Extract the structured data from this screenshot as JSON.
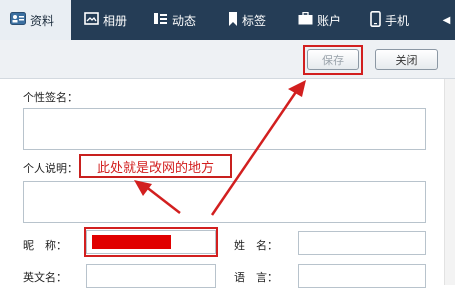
{
  "tabs": [
    {
      "label": "资料",
      "icon": "profile-card-icon"
    },
    {
      "label": "相册",
      "icon": "photo-album-icon"
    },
    {
      "label": "动态",
      "icon": "feed-list-icon"
    },
    {
      "label": "标签",
      "icon": "bookmark-icon"
    },
    {
      "label": "账户",
      "icon": "briefcase-icon"
    },
    {
      "label": "手机",
      "icon": "phone-icon"
    }
  ],
  "tab_scroll": "◀",
  "toolbar": {
    "save_label": "保存",
    "close_label": "关闭"
  },
  "form": {
    "signature_label": "个性签名：",
    "description_label": "个人说明：",
    "nickname_label": "昵　称：",
    "name_label": "姓　名：",
    "english_name_label": "英文名：",
    "language_label": "语　言："
  },
  "annotation": {
    "text": "此处就是改网的地方"
  },
  "colors": {
    "tabbar": "#253d56",
    "annotation_red": "#d21f1f"
  }
}
